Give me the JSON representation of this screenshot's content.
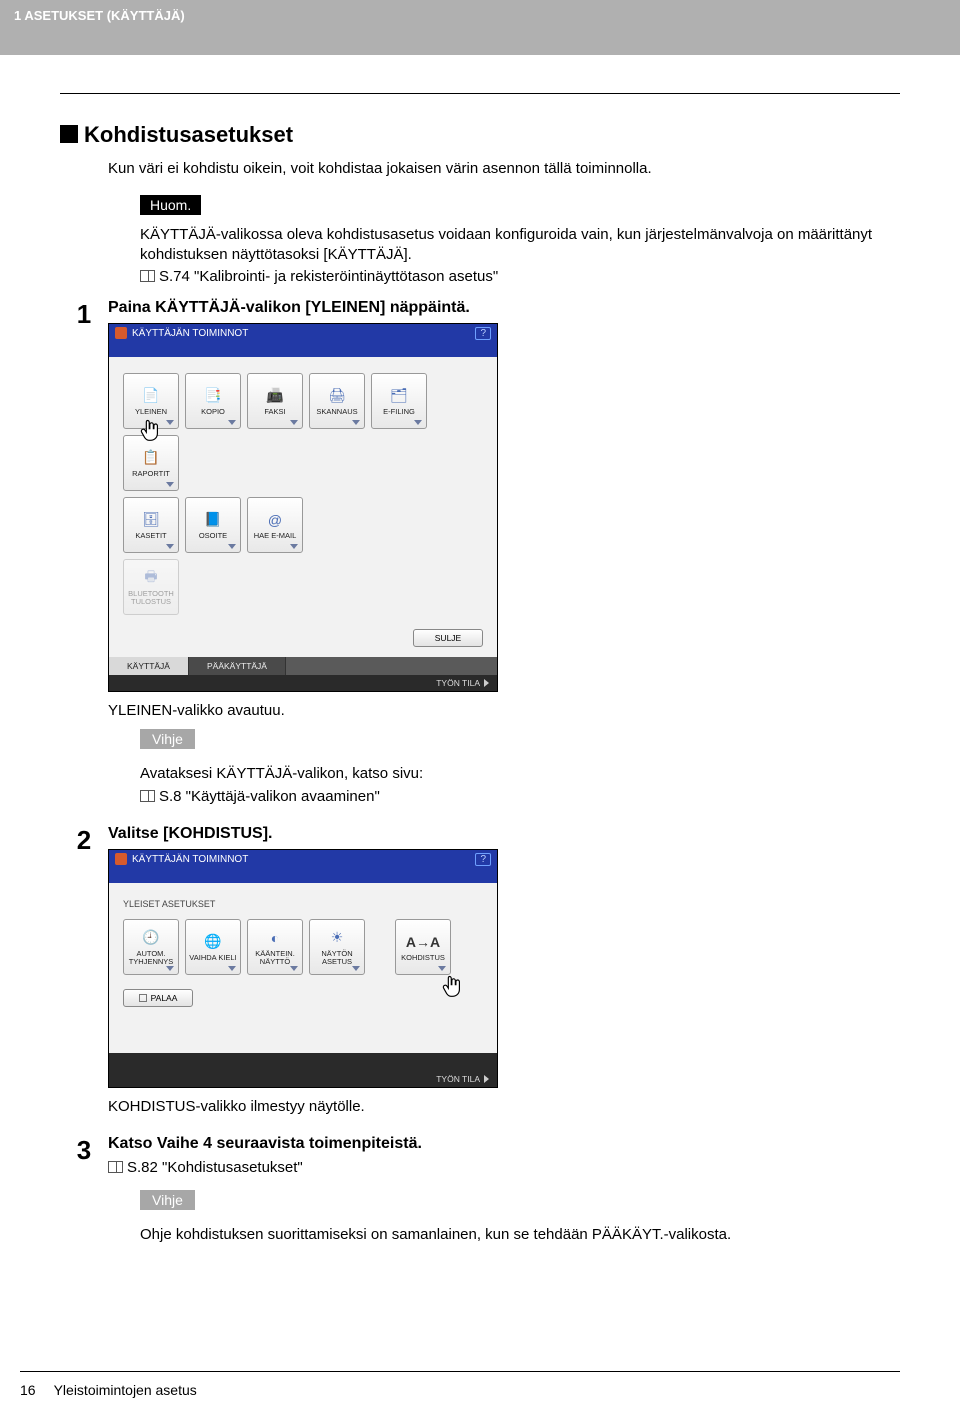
{
  "header": {
    "chapter": "1 ASETUKSET (KÄYTTÄJÄ)"
  },
  "section": {
    "title": "Kohdistusasetukset",
    "intro": "Kun väri ei kohdistu oikein, voit kohdistaa jokaisen värin asennon tällä toiminnolla.",
    "note_label": "Huom.",
    "note_body": "KÄYTTÄJÄ-valikossa oleva kohdistusasetus voidaan konfiguroida vain, kun järjestelmänvalvoja on määrittänyt kohdistuksen näyttötasoksi [KÄYTTÄJÄ].",
    "ref1": "S.74 \"Kalibrointi- ja rekisteröintinäyttötason asetus\""
  },
  "steps": [
    {
      "num": "1",
      "title": "Paina KÄYTTÄJÄ-valikon [YLEINEN] näppäintä."
    },
    {
      "num": "2",
      "title": "Valitse [KOHDISTUS]."
    },
    {
      "num": "3",
      "title": "Katso Vaihe 4 seuraavista toimenpiteistä."
    }
  ],
  "after_shot1": "YLEINEN-valikko avautuu.",
  "tip_label": "Vihje",
  "tip1_line1": "Avataksesi KÄYTTÄJÄ-valikon, katso sivu:",
  "tip1_ref": "S.8 \"Käyttäjä-valikon avaaminen\"",
  "after_shot2": "KOHDISTUS-valikko ilmestyy näytölle.",
  "ref3": "S.82 \"Kohdistusasetukset\"",
  "tip2_body": "Ohje kohdistuksen suorittamiseksi on samanlainen, kun se tehdään PÄÄKÄYT.-valikosta.",
  "shot": {
    "titlebar": "KÄYTTÄJÄN TOIMINNOT",
    "help": "?",
    "row1": [
      "YLEINEN",
      "KOPIO",
      "FAKSI",
      "SKANNAUS",
      "E-FILING",
      "RAPORTIT"
    ],
    "row2": [
      "KASETIT",
      "OSOITE",
      "HAE E-MAIL"
    ],
    "row2_dis": "BLUETOOTH TULOSTUS",
    "sulje": "SULJE",
    "tab_user": "KÄYTTÄJÄ",
    "tab_admin": "PÄÄKÄYTTÄJÄ",
    "foot": "TYÖN TILA"
  },
  "shot2": {
    "subhead": "YLEISET ASETUKSET",
    "btns": [
      "AUTOM. TYHJENNYS",
      "VAIHDA KIELI",
      "KÄÄNTEIN. NÄYTTÖ",
      "NÄYTÖN ASETUS"
    ],
    "btn_sep": "KOHDISTUS",
    "palaa": "PALAA"
  },
  "footer": {
    "page": "16",
    "title": "Yleistoimintojen asetus"
  }
}
